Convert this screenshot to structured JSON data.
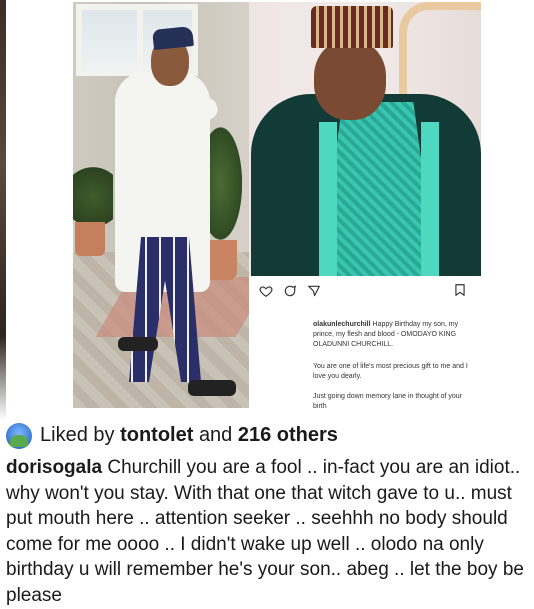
{
  "post": {
    "caption_username": "olakunlechurchill",
    "caption_text": "Happy Birthday my son, my prince, my flesh and blood - OMODAYO KING OLADUNNI CHURCHILL.",
    "caption_line2": "You are one of life's most precious gift to me and I love you dearly.",
    "caption_line3": "Just going down memory lane in thought of your birth",
    "icons": [
      "heart-icon",
      "comment-icon",
      "share-icon",
      "bookmark-icon"
    ]
  },
  "likes": {
    "prefix": "Liked by",
    "user": "tontolet",
    "connector": "and",
    "count": "216 others"
  },
  "comment": {
    "username": "dorisogala",
    "lines": [
      "Churchill you are a fool .. in-fact you are an idiot..",
      "why won't you stay. With that one that witch gave to u.. must",
      "put mouth here .. attention seeker .. seehhh no body should",
      "come for me oooo .. I didn't wake up well .. olodo na only",
      "birthday u will remember he's your son.. abeg .. let the boy be",
      "please"
    ]
  },
  "colors": {
    "text": "#1a1a1a",
    "background": "#ffffff",
    "agbada_teal": "#39c6b0"
  }
}
